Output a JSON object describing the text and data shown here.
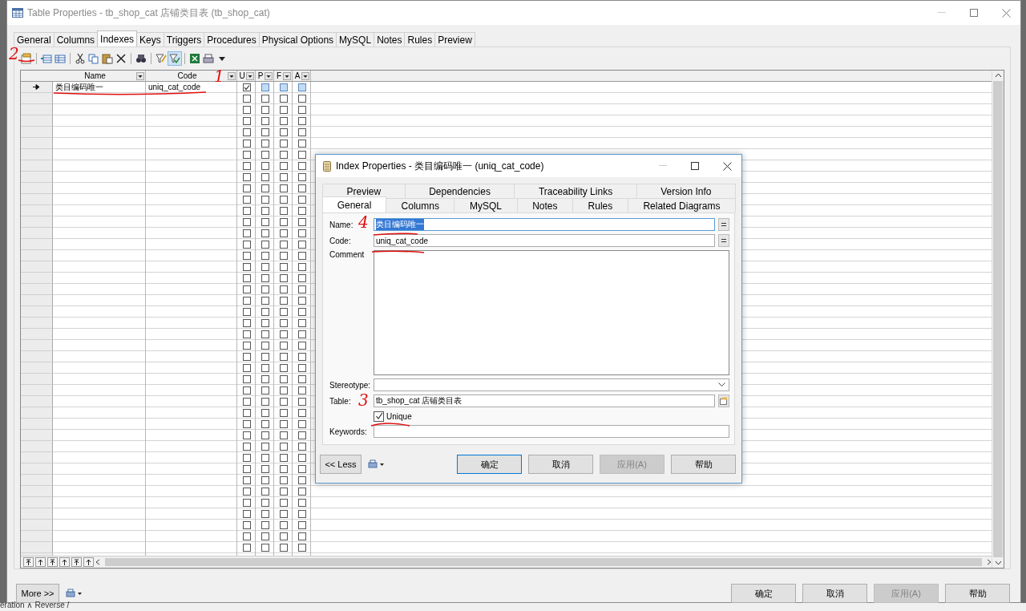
{
  "window": {
    "title": "Table Properties - tb_shop_cat 店铺类目表 (tb_shop_cat)"
  },
  "tabs": [
    {
      "label": "General",
      "selected": false
    },
    {
      "label": "Columns",
      "selected": false
    },
    {
      "label": "Indexes",
      "selected": true
    },
    {
      "label": "Keys",
      "selected": false
    },
    {
      "label": "Triggers",
      "selected": false
    },
    {
      "label": "Procedures",
      "selected": false
    },
    {
      "label": "Physical Options",
      "selected": false
    },
    {
      "label": "MySQL",
      "selected": false
    },
    {
      "label": "Notes",
      "selected": false
    },
    {
      "label": "Rules",
      "selected": false
    },
    {
      "label": "Preview",
      "selected": false
    }
  ],
  "toolbar": [
    {
      "kind": "properties",
      "pressed": false
    },
    {
      "kind": "sep"
    },
    {
      "kind": "insert-row",
      "pressed": false
    },
    {
      "kind": "add-row",
      "pressed": false
    },
    {
      "kind": "sep"
    },
    {
      "kind": "cut",
      "pressed": false
    },
    {
      "kind": "copy",
      "pressed": false
    },
    {
      "kind": "paste",
      "pressed": false
    },
    {
      "kind": "delete",
      "pressed": false
    },
    {
      "kind": "sep"
    },
    {
      "kind": "find",
      "pressed": false
    },
    {
      "kind": "sep"
    },
    {
      "kind": "filter",
      "pressed": false
    },
    {
      "kind": "filter-check",
      "pressed": true
    },
    {
      "kind": "sep"
    },
    {
      "kind": "spreadsheet",
      "pressed": false
    },
    {
      "kind": "print",
      "pressed": false
    },
    {
      "kind": "dropdown",
      "pressed": false
    }
  ],
  "grid": {
    "columns": [
      {
        "label": "Name"
      },
      {
        "label": "Code"
      },
      {
        "label": "U"
      },
      {
        "label": "P"
      },
      {
        "label": "F"
      },
      {
        "label": "A"
      }
    ],
    "rows": [
      {
        "current": true,
        "name": "类目编码唯一",
        "code": "uniq_cat_code",
        "unique": true,
        "primary": false,
        "foreign": false,
        "cluster": false
      },
      {
        "current": false,
        "unique": false,
        "primary": false,
        "foreign": false,
        "cluster": false
      },
      {
        "current": false,
        "unique": false,
        "primary": false,
        "foreign": false,
        "cluster": false
      },
      {
        "current": false,
        "unique": false,
        "primary": false,
        "foreign": false,
        "cluster": false
      },
      {
        "current": false,
        "unique": false,
        "primary": false,
        "foreign": false,
        "cluster": false
      },
      {
        "current": false,
        "unique": false,
        "primary": false,
        "foreign": false,
        "cluster": false
      },
      {
        "current": false,
        "unique": false,
        "primary": false,
        "foreign": false,
        "cluster": false
      },
      {
        "current": false,
        "unique": false,
        "primary": false,
        "foreign": false,
        "cluster": false
      },
      {
        "current": false,
        "unique": false,
        "primary": false,
        "foreign": false,
        "cluster": false
      },
      {
        "current": false,
        "unique": false,
        "primary": false,
        "foreign": false,
        "cluster": false
      },
      {
        "current": false,
        "unique": false,
        "primary": false,
        "foreign": false,
        "cluster": false
      },
      {
        "current": false,
        "unique": false,
        "primary": false,
        "foreign": false,
        "cluster": false
      },
      {
        "current": false,
        "unique": false,
        "primary": false,
        "foreign": false,
        "cluster": false
      },
      {
        "current": false,
        "unique": false,
        "primary": false,
        "foreign": false,
        "cluster": false
      },
      {
        "current": false,
        "unique": false,
        "primary": false,
        "foreign": false,
        "cluster": false
      },
      {
        "current": false,
        "unique": false,
        "primary": false,
        "foreign": false,
        "cluster": false
      },
      {
        "current": false,
        "unique": false,
        "primary": false,
        "foreign": false,
        "cluster": false
      },
      {
        "current": false,
        "unique": false,
        "primary": false,
        "foreign": false,
        "cluster": false
      },
      {
        "current": false,
        "unique": false,
        "primary": false,
        "foreign": false,
        "cluster": false
      },
      {
        "current": false,
        "unique": false,
        "primary": false,
        "foreign": false,
        "cluster": false
      },
      {
        "current": false,
        "unique": false,
        "primary": false,
        "foreign": false,
        "cluster": false
      },
      {
        "current": false,
        "unique": false,
        "primary": false,
        "foreign": false,
        "cluster": false
      },
      {
        "current": false,
        "unique": false,
        "primary": false,
        "foreign": false,
        "cluster": false
      },
      {
        "current": false,
        "unique": false,
        "primary": false,
        "foreign": false,
        "cluster": false
      },
      {
        "current": false,
        "unique": false,
        "primary": false,
        "foreign": false,
        "cluster": false
      },
      {
        "current": false,
        "unique": false,
        "primary": false,
        "foreign": false,
        "cluster": false
      },
      {
        "current": false,
        "unique": false,
        "primary": false,
        "foreign": false,
        "cluster": false
      },
      {
        "current": false,
        "unique": false,
        "primary": false,
        "foreign": false,
        "cluster": false
      },
      {
        "current": false,
        "unique": false,
        "primary": false,
        "foreign": false,
        "cluster": false
      },
      {
        "current": false,
        "unique": false,
        "primary": false,
        "foreign": false,
        "cluster": false
      },
      {
        "current": false,
        "unique": false,
        "primary": false,
        "foreign": false,
        "cluster": false
      },
      {
        "current": false,
        "unique": false,
        "primary": false,
        "foreign": false,
        "cluster": false
      },
      {
        "current": false,
        "unique": false,
        "primary": false,
        "foreign": false,
        "cluster": false
      },
      {
        "current": false,
        "unique": false,
        "primary": false,
        "foreign": false,
        "cluster": false
      },
      {
        "current": false,
        "unique": false,
        "primary": false,
        "foreign": false,
        "cluster": false
      },
      {
        "current": false,
        "unique": false,
        "primary": false,
        "foreign": false,
        "cluster": false
      },
      {
        "current": false,
        "unique": false,
        "primary": false,
        "foreign": false,
        "cluster": false
      },
      {
        "current": false,
        "unique": false,
        "primary": false,
        "foreign": false,
        "cluster": false
      },
      {
        "current": false,
        "unique": false,
        "primary": false,
        "foreign": false,
        "cluster": false
      },
      {
        "current": false,
        "unique": false,
        "primary": false,
        "foreign": false,
        "cluster": false
      },
      {
        "current": false,
        "unique": false,
        "primary": false,
        "foreign": false,
        "cluster": false
      },
      {
        "current": false,
        "unique": false,
        "primary": false,
        "foreign": false,
        "cluster": false
      }
    ]
  },
  "more_button": "More >>",
  "footer_buttons": [
    {
      "label": "确定",
      "disabled": false
    },
    {
      "label": "取消",
      "disabled": false
    },
    {
      "label": "应用(A)",
      "disabled": true
    },
    {
      "label": "帮助",
      "disabled": false
    }
  ],
  "dialog": {
    "title": "Index Properties - 类目编码唯一 (uniq_cat_code)",
    "tab_rows": [
      [
        {
          "label": "Preview",
          "selected": false
        },
        {
          "label": "Dependencies",
          "selected": false
        },
        {
          "label": "Traceability Links",
          "selected": false
        },
        {
          "label": "Version Info",
          "selected": false
        }
      ],
      [
        {
          "label": "General",
          "selected": true
        },
        {
          "label": "Columns",
          "selected": false
        },
        {
          "label": "MySQL",
          "selected": false
        },
        {
          "label": "Notes",
          "selected": false
        },
        {
          "label": "Rules",
          "selected": false
        },
        {
          "label": "Related Diagrams",
          "selected": false
        }
      ]
    ],
    "name": {
      "label": "Name:",
      "value": "类目编码唯一",
      "text_selected": true
    },
    "code": {
      "label": "Code:",
      "value": "uniq_cat_code"
    },
    "comment": {
      "label": "Comment"
    },
    "stereotype": {
      "label": "Stereotype:"
    },
    "table": {
      "label": "Table:",
      "value": "tb_shop_cat 店铺类目表"
    },
    "unique": {
      "label": "Unique",
      "checked": true
    },
    "keywords": {
      "label": "Keywords:"
    },
    "less_button": "<< Less",
    "buttons": [
      {
        "label": "确定",
        "default": true,
        "disabled": false
      },
      {
        "label": "取消",
        "default": false,
        "disabled": false
      },
      {
        "label": "应用(A)",
        "default": false,
        "disabled": true
      },
      {
        "label": "帮助",
        "default": false,
        "disabled": false
      }
    ]
  },
  "annotations": [
    {
      "text": "2"
    },
    {
      "text": "1"
    },
    {
      "text": "4"
    },
    {
      "text": "3"
    }
  ],
  "background_text": "eration ∧ Reverse /"
}
